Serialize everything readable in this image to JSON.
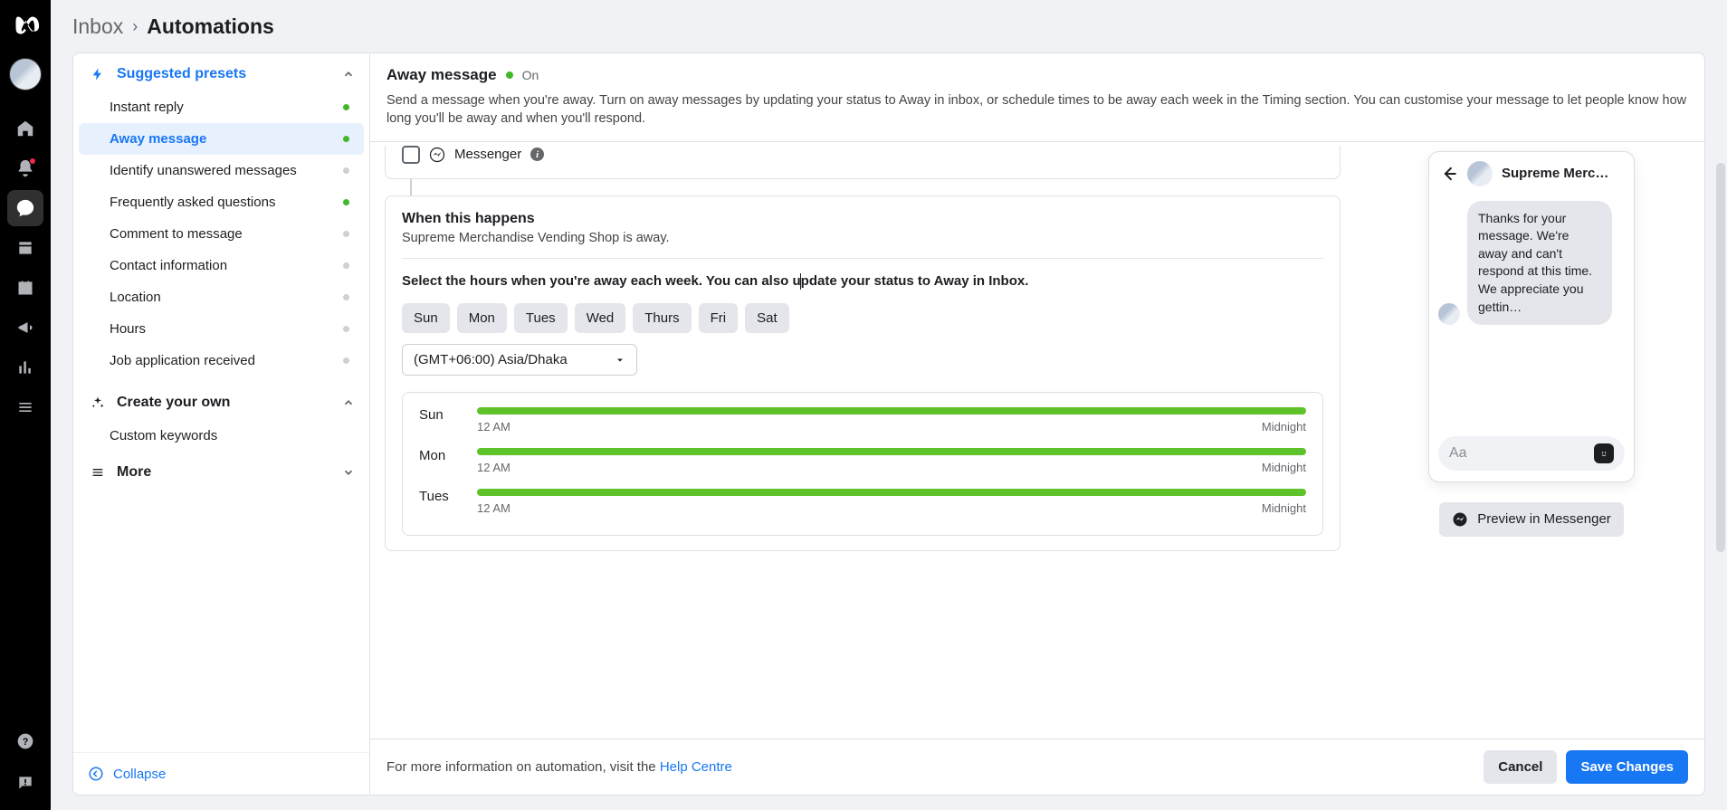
{
  "breadcrumb": {
    "first": "Inbox",
    "second": "Automations"
  },
  "presets": {
    "suggested_title": "Suggested presets",
    "items": [
      {
        "label": "Instant reply",
        "status": "on"
      },
      {
        "label": "Away message",
        "status": "on",
        "active": true
      },
      {
        "label": "Identify unanswered messages",
        "status": "off"
      },
      {
        "label": "Frequently asked questions",
        "status": "on"
      },
      {
        "label": "Comment to message",
        "status": "off"
      },
      {
        "label": "Contact information",
        "status": "off"
      },
      {
        "label": "Location",
        "status": "off"
      },
      {
        "label": "Hours",
        "status": "off"
      },
      {
        "label": "Job application received",
        "status": "off"
      }
    ],
    "create_title": "Create your own",
    "create_items": [
      {
        "label": "Custom keywords"
      }
    ],
    "more_title": "More",
    "collapse_label": "Collapse"
  },
  "detail": {
    "title": "Away message",
    "status_label": "On",
    "description": "Send a message when you're away. Turn on away messages by updating your status to Away in inbox, or schedule times to be away each week in the Timing section. You can customise your message to let people know how long you'll be away and when you'll respond.",
    "channel_label": "Messenger",
    "when_title": "When this happens",
    "when_subtitle": "Supreme Merchandise Vending Shop is away.",
    "select_hours_text": "Select the hours when you're away each week. You can also update your status to Away in Inbox.",
    "days": [
      "Sun",
      "Mon",
      "Tues",
      "Wed",
      "Thurs",
      "Fri",
      "Sat"
    ],
    "timezone": "(GMT+06:00) Asia/Dhaka",
    "schedule": [
      {
        "day": "Sun",
        "start": "12 AM",
        "end": "Midnight"
      },
      {
        "day": "Mon",
        "start": "12 AM",
        "end": "Midnight"
      },
      {
        "day": "Tues",
        "start": "12 AM",
        "end": "Midnight"
      }
    ]
  },
  "preview": {
    "page_name": "Supreme Merc…",
    "bubble_text": "Thanks for your message. We're away and can't respond at this time. We appreciate you gettin…",
    "input_placeholder": "Aa",
    "button_label": "Preview in Messenger"
  },
  "footer": {
    "help_prefix": "For more information on automation, visit the ",
    "help_link": "Help Centre",
    "cancel": "Cancel",
    "save": "Save Changes"
  }
}
